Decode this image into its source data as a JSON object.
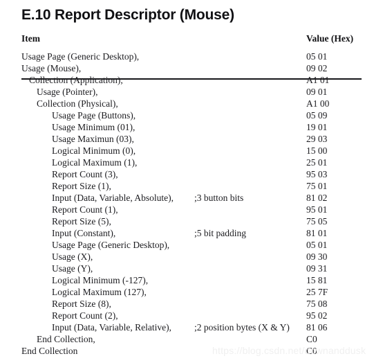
{
  "title": "E.10 Report Descriptor (Mouse)",
  "table": {
    "headers": {
      "item": "Item",
      "comment": "",
      "value": "Value (Hex)"
    },
    "rows": [
      {
        "item": "Usage Page (Generic Desktop),",
        "indent": 0,
        "comment": "",
        "value": "05 01"
      },
      {
        "item": "Usage (Mouse),",
        "indent": 0,
        "comment": "",
        "value": "09 02"
      },
      {
        "item": "Collection (Application),",
        "indent": 1,
        "comment": "",
        "value": "A1 01"
      },
      {
        "item": "Usage (Pointer),",
        "indent": 2,
        "comment": "",
        "value": "09 01"
      },
      {
        "item": "Collection (Physical),",
        "indent": 2,
        "comment": "",
        "value": "A1 00"
      },
      {
        "item": "Usage Page (Buttons),",
        "indent": 4,
        "comment": "",
        "value": "05 09"
      },
      {
        "item": "Usage Minimum (01),",
        "indent": 4,
        "comment": "",
        "value": "19 01"
      },
      {
        "item": "Usage Maximun (03),",
        "indent": 4,
        "comment": "",
        "value": "29 03"
      },
      {
        "item": "Logical Minimum (0),",
        "indent": 4,
        "comment": "",
        "value": "15 00"
      },
      {
        "item": "Logical Maximum (1),",
        "indent": 4,
        "comment": "",
        "value": "25 01"
      },
      {
        "item": "Report Count (3),",
        "indent": 4,
        "comment": "",
        "value": "95 03"
      },
      {
        "item": "Report Size (1),",
        "indent": 4,
        "comment": "",
        "value": "75 01"
      },
      {
        "item": "Input (Data, Variable, Absolute),",
        "indent": 4,
        "comment": ";3 button bits",
        "value": "81 02"
      },
      {
        "item": "Report Count (1),",
        "indent": 4,
        "comment": "",
        "value": "95 01"
      },
      {
        "item": "Report Size (5),",
        "indent": 4,
        "comment": "",
        "value": "75 05"
      },
      {
        "item": "Input (Constant),",
        "indent": 4,
        "comment": ";5 bit padding",
        "value": "81 01"
      },
      {
        "item": "Usage Page (Generic Desktop),",
        "indent": 4,
        "comment": "",
        "value": "05 01"
      },
      {
        "item": "Usage (X),",
        "indent": 4,
        "comment": "",
        "value": "09 30"
      },
      {
        "item": "Usage (Y),",
        "indent": 4,
        "comment": "",
        "value": "09 31"
      },
      {
        "item": "Logical Minimum (-127),",
        "indent": 4,
        "comment": "",
        "value": "15 81"
      },
      {
        "item": "Logical Maximum (127),",
        "indent": 4,
        "comment": "",
        "value": "25 7F"
      },
      {
        "item": "Report Size (8),",
        "indent": 4,
        "comment": "",
        "value": "75 08"
      },
      {
        "item": "Report Count (2),",
        "indent": 4,
        "comment": "",
        "value": "95 02"
      },
      {
        "item": "Input (Data, Variable, Relative),",
        "indent": 4,
        "comment": ";2 position bytes (X & Y)",
        "value": "81 06"
      },
      {
        "item": "End Collection,",
        "indent": 2,
        "comment": "",
        "value": "C0"
      },
      {
        "item": "End Collection",
        "indent": 0,
        "comment": "",
        "value": "C0"
      }
    ]
  },
  "watermark": "https://blog.csdn.net/downanddusk"
}
